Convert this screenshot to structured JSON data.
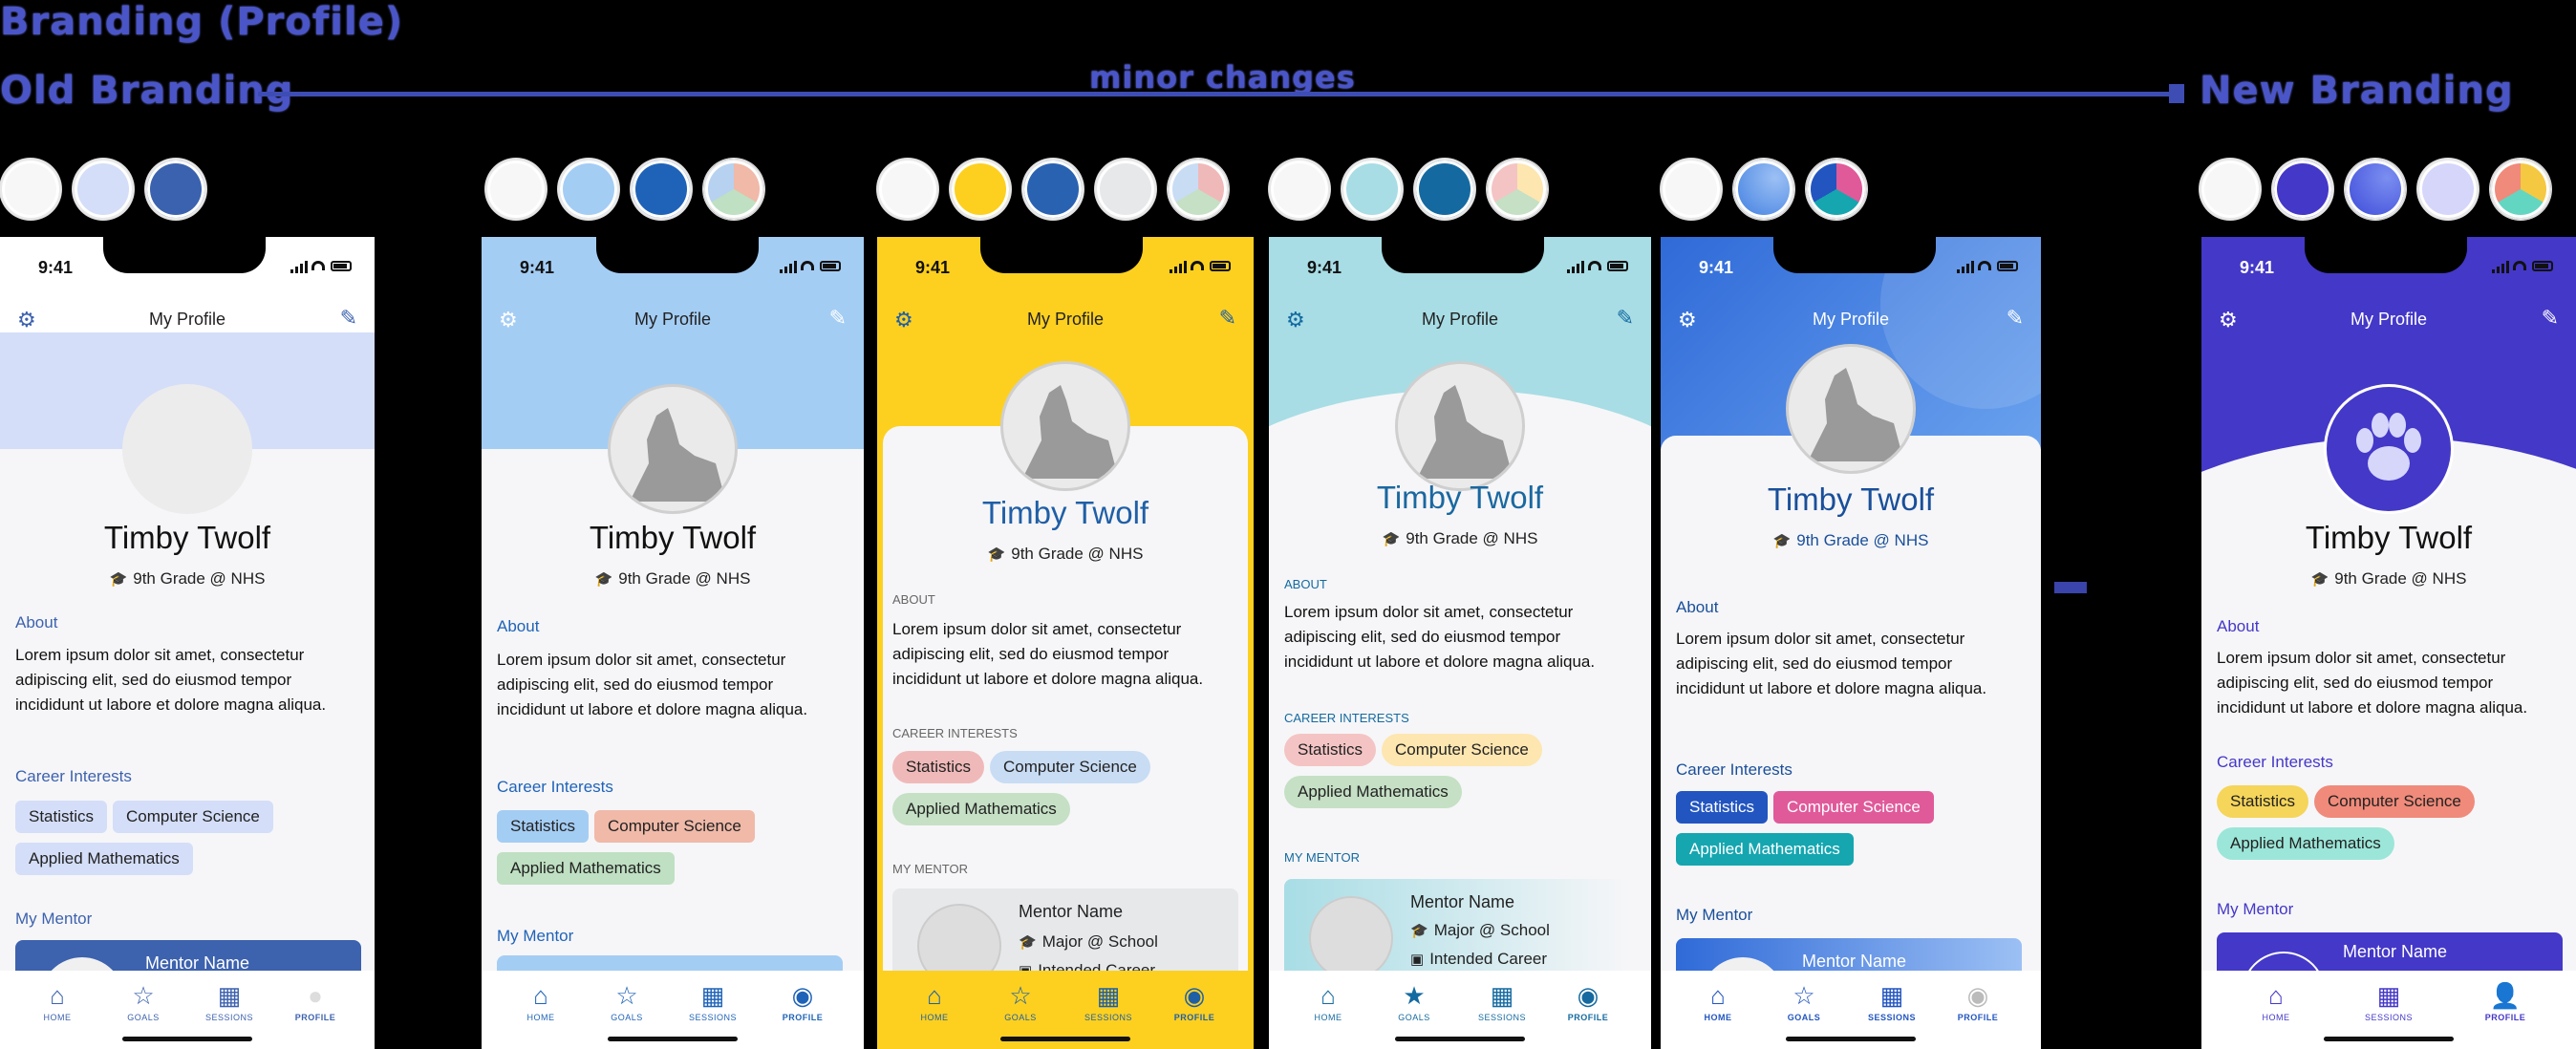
{
  "header": {
    "title": "Branding (Profile)",
    "old_label": "Old Branding",
    "new_label": "New Branding",
    "middle_label": "minor changes"
  },
  "shared": {
    "time": "9:41",
    "page_title": "My Profile",
    "name": "Timby Twolf",
    "grade": "9th Grade @ NHS",
    "about_text": "Lorem ipsum dolor sit amet, consectetur adipiscing elit, sed do eiusmod tempor incididunt ut labore et dolore magna aliqua.",
    "chips": [
      "Statistics",
      "Computer Science",
      "Applied Mathematics"
    ],
    "mentor_name": "Mentor Name",
    "mentor_school": "Major @ School",
    "mentor_career": "Intended Career",
    "tabs": {
      "home": "HOME",
      "goals": "GOALS",
      "sessions": "SESSIONS",
      "profile": "PROFILE"
    }
  },
  "phones": [
    {
      "about_label": "About",
      "career_label": "Career Interests",
      "mentor_label": "My Mentor",
      "accent": "#3d62ae",
      "swatches": [
        "#f7f7f7",
        "#d4def8",
        "#3b62ae"
      ]
    },
    {
      "about_label": "About",
      "career_label": "Career Interests",
      "mentor_label": "My Mentor",
      "accent": "#1f63b8",
      "swatches": [
        "#f7f7f7",
        "#a4cdf4",
        "#1f63b8",
        "tri:#f0b9a8,#bfe0c2,#b7d2f0"
      ]
    },
    {
      "about_label": "ABOUT",
      "career_label": "CAREER INTERESTS",
      "mentor_label": "MY MENTOR",
      "accent": "#1f5fa6",
      "swatches": [
        "#f7f7f7",
        "#fdd020",
        "#2a62b2",
        "#e6e8ea",
        "tri:#f0b9b9,#c5e0c5,#c8dcf4"
      ]
    },
    {
      "about_label": "ABOUT",
      "career_label": "CAREER INTERESTS",
      "mentor_label": "MY MENTOR",
      "accent": "#1a68a0",
      "swatches": [
        "#f7f7f7",
        "#a8dde5",
        "#146aa0",
        "tri:#fde6b0,#c5e0c5,#f4c4c4"
      ]
    },
    {
      "about_label": "About",
      "career_label": "Career Interests",
      "mentor_label": "My Mentor",
      "accent": "#1a4f9a",
      "swatches": [
        "#f7f7f7",
        "#3d7de0",
        "tri:#e05a9a,#15a6b0,#2255c0"
      ]
    },
    {
      "about_label": "About",
      "career_label": "Career Interests",
      "mentor_label": "My Mentor",
      "accent": "#4438c8",
      "swatches": [
        "#f7f7f7",
        "#4438c8",
        "#4a5ce6",
        "#d6d6fb",
        "tri:#f5c842,#63d6c2,#f08a7a"
      ]
    }
  ]
}
